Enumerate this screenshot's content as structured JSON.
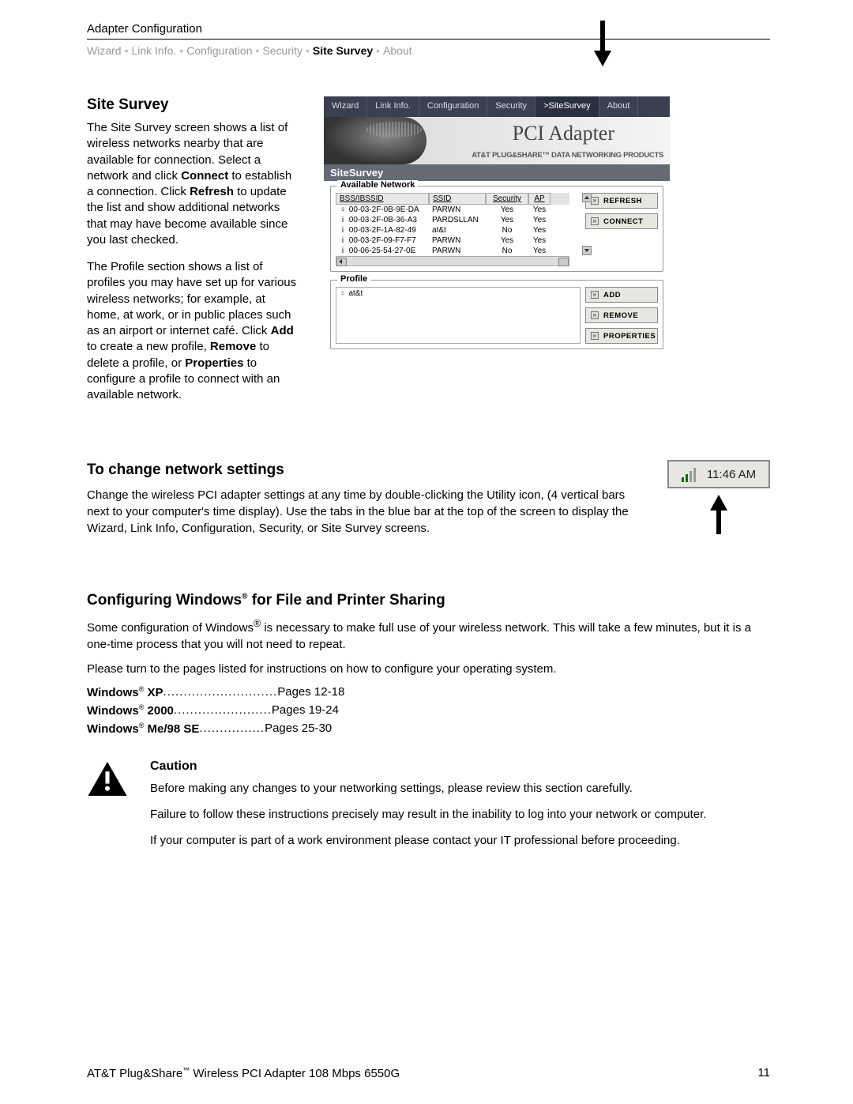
{
  "top_header": "Adapter Configuration",
  "breadcrumb": {
    "items": [
      "Wizard",
      "Link Info.",
      "Configuration",
      "Security",
      "Site Survey",
      "About"
    ],
    "active_index": 4
  },
  "site_survey": {
    "heading": "Site Survey",
    "para1_parts": [
      "The Site Survey screen shows a list of wireless networks nearby that are available for connection. Select a network and click ",
      "Connect",
      " to establish a connection. Click ",
      "Refresh",
      " to update the list and show additional networks that may have become available since you last checked."
    ],
    "para2_parts": [
      "The Profile section shows a list of profiles you may have set up for various wireless networks; for example, at home, at work, or in public places such as an airport or internet café. Click ",
      "Add",
      " to create a new profile, ",
      "Remove",
      " to delete a profile, or ",
      "Properties",
      " to configure a profile to connect with an available network."
    ]
  },
  "app": {
    "tabs": [
      "Wizard",
      "Link Info.",
      "Configuration",
      "Security",
      ">SiteSurvey",
      "About"
    ],
    "tabs_active_index": 4,
    "banner_title": "PCI Adapter",
    "banner_sub": "AT&T PLUG&SHARE™ DATA NETWORKING PRODUCTS",
    "section_bar": "SiteSurvey",
    "available_legend": "Available Network",
    "headers": {
      "bss": "BSS/IBSSID",
      "ssid": "SSID",
      "sec": "Security",
      "ap": "AP"
    },
    "networks": [
      {
        "icon": "♀",
        "bss": "00-03-2F-0B-9E-DA",
        "ssid": "PARWN",
        "sec": "Yes",
        "ap": "Yes"
      },
      {
        "icon": "i",
        "bss": "00-03-2F-0B-36-A3",
        "ssid": "PARDSLLAN",
        "sec": "Yes",
        "ap": "Yes"
      },
      {
        "icon": "i",
        "bss": "00-03-2F-1A-82-49",
        "ssid": "at&t",
        "sec": "No",
        "ap": "Yes"
      },
      {
        "icon": "i",
        "bss": "00-03-2F-09-F7-F7",
        "ssid": "PARWN",
        "sec": "Yes",
        "ap": "Yes"
      },
      {
        "icon": "i",
        "bss": "00-06-25-54-27-0E",
        "ssid": "PARWN",
        "sec": "No",
        "ap": "Yes"
      }
    ],
    "buttons": {
      "refresh": "REFRESH",
      "connect": "CONNECT",
      "add": "ADD",
      "remove": "REMOVE",
      "properties": "PROPERTIES"
    },
    "profile_legend": "Profile",
    "profile_items": [
      {
        "name": "at&t"
      }
    ]
  },
  "change_settings": {
    "heading": "To change network settings",
    "para_parts": [
      "Change the wireless PCI adapter settings at any time by double-clicking the ",
      "Utility",
      " icon, (4 vertical bars next to your computer's time display). Use the tabs in the blue bar at the top of the screen to display the Wizard, Link Info, Configuration, Security, or Site Survey screens."
    ],
    "clock_time": "11:46 AM"
  },
  "configuring": {
    "heading_parts": [
      "Configuring Windows",
      " for File and Printer Sharing"
    ],
    "para1_parts": [
      "Some configuration of Windows",
      " is necessary to make full use of your wireless network. This will take a few minutes, but it is a one-time process that you will not need to repeat."
    ],
    "para2": "Please turn to the pages listed for instructions on how to configure your operating system.",
    "os_rows": [
      {
        "name": "Windows",
        "suffix": " XP",
        "dots": " ............................",
        "pages": "Pages 12-18"
      },
      {
        "name": "Windows",
        "suffix": " 2000",
        "dots": " ........................",
        "pages": "Pages 19-24"
      },
      {
        "name": "Windows",
        "suffix": " Me/98 SE",
        "dots": " ................",
        "pages": "Pages 25-30"
      }
    ]
  },
  "caution": {
    "heading": "Caution",
    "p1": "Before making any changes to your networking settings, please review this section carefully.",
    "p2": "Failure to follow these instructions precisely may result in the inability to log into your network or computer.",
    "p3": "If your computer is part of a work environment please contact your IT professional before proceeding."
  },
  "footer": {
    "left_parts": [
      "AT&T Plug&Share",
      " Wireless PCI Adapter 108 Mbps 6550G"
    ],
    "right": "11"
  }
}
